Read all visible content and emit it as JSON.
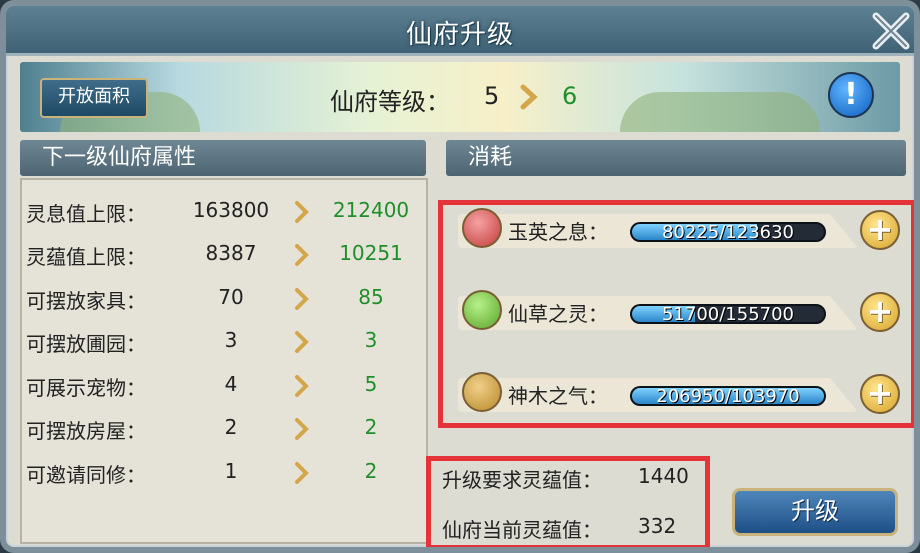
{
  "window": {
    "title": "仙府升级"
  },
  "banner": {
    "open_area_label": "开放面积",
    "level_label": "仙府等级：",
    "level_current": "5",
    "level_next": "6",
    "info_icon": "info-icon"
  },
  "left_panel": {
    "title": "下一级仙府属性",
    "rows": [
      {
        "label": "灵息值上限：",
        "current": "163800",
        "next": "212400"
      },
      {
        "label": "灵蕴值上限：",
        "current": "8387",
        "next": "10251"
      },
      {
        "label": "可摆放家具：",
        "current": "70",
        "next": "85"
      },
      {
        "label": "可摆放圃园：",
        "current": "3",
        "next": "3"
      },
      {
        "label": "可展示宠物：",
        "current": "4",
        "next": "5"
      },
      {
        "label": "可摆放房屋：",
        "current": "2",
        "next": "2"
      },
      {
        "label": "可邀请同修：",
        "current": "1",
        "next": "2"
      }
    ]
  },
  "right_panel": {
    "title": "消耗",
    "costs": [
      {
        "name": "玉英之息：",
        "progress_text": "80225/123630",
        "progress_fraction": 0.65,
        "icon": "jade-essence-icon",
        "icon_color": "#c43b3b"
      },
      {
        "name": "仙草之灵：",
        "progress_text": "51700/155700",
        "progress_fraction": 0.33,
        "icon": "herb-spirit-icon",
        "icon_color": "#5aa52a"
      },
      {
        "name": "神木之气：",
        "progress_text": "206950/103970",
        "progress_fraction": 1.0,
        "icon": "divine-wood-icon",
        "icon_color": "#b8892a"
      }
    ],
    "add_label": "+"
  },
  "requirements": {
    "required_label": "升级要求灵蕴值：",
    "required_value": "1440",
    "current_label": "仙府当前灵蕴值：",
    "current_value": "332"
  },
  "upgrade_button": {
    "label": "升级"
  },
  "colors": {
    "next_value": "#1f8f2a",
    "highlight_border": "#e5333a"
  }
}
